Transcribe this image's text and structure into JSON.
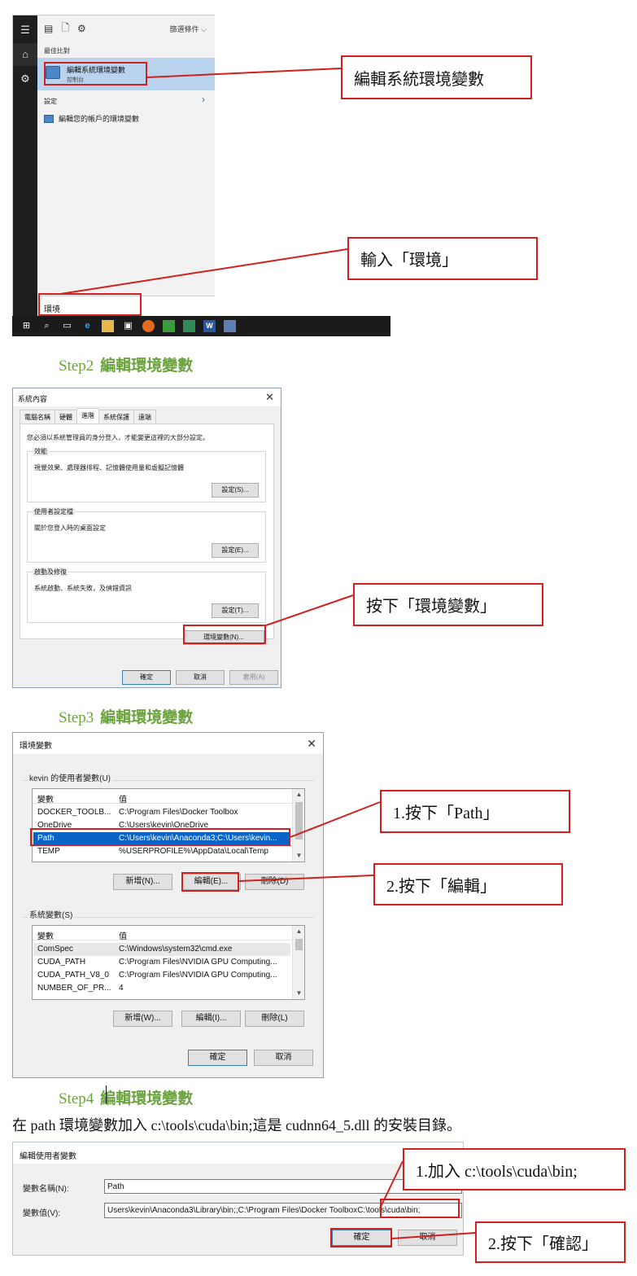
{
  "step1": {
    "start_menu": {
      "filter_label": "篩選條件",
      "best_match_label": "最佳比對",
      "best_match_title": "編輯系統環境變數",
      "best_match_subtitle": "控制台",
      "settings_label": "設定",
      "account_env_item": "編輯您的帳戶的環境變數",
      "search_text": "環境"
    },
    "callout_edit_env": "編輯系統環境變數",
    "callout_type_env": "輸入「環境」"
  },
  "step2": {
    "heading_num": "Step2",
    "heading_text": "編輯環境變數",
    "dialog": {
      "title": "系統內容",
      "tabs": [
        "電腦名稱",
        "硬體",
        "進階",
        "系統保護",
        "遠端"
      ],
      "note": "您必須以系統管理員的身分登入，才能變更這裡的大部分設定。",
      "performance": {
        "label": "效能",
        "desc": "視覺效果、處理器排程、記憶體使用量和虛擬記憶體",
        "button": "設定(S)..."
      },
      "profile": {
        "label": "使用者設定檔",
        "desc": "關於您登入時的桌面設定",
        "button": "設定(E)..."
      },
      "startup": {
        "label": "啟動及修復",
        "desc": "系統啟動、系統失敗，及偵錯資訊",
        "button": "設定(T)..."
      },
      "env_button": "環境變數(N)...",
      "ok": "確定",
      "cancel": "取消",
      "apply": "套用(A)"
    },
    "callout": "按下「環境變數」"
  },
  "step3": {
    "heading_num": "Step3",
    "heading_text": "編輯環境變數",
    "dialog": {
      "title": "環境變數",
      "user_group_label": "kevin 的使用者變數(U)",
      "col_var": "變數",
      "col_val": "值",
      "user_vars": [
        {
          "name": "DOCKER_TOOLB...",
          "value": "C:\\Program Files\\Docker Toolbox"
        },
        {
          "name": "OneDrive",
          "value": "C:\\Users\\kevin\\OneDrive"
        },
        {
          "name": "Path",
          "value": "C:\\Users\\kevin\\Anaconda3;C:\\Users\\kevin..."
        },
        {
          "name": "TEMP",
          "value": "%USERPROFILE%\\AppData\\Local\\Temp"
        }
      ],
      "user_buttons": {
        "new": "新增(N)...",
        "edit": "編輯(E)...",
        "delete": "刪除(D)"
      },
      "sys_group_label": "系統變數(S)",
      "sys_vars": [
        {
          "name": "ComSpec",
          "value": "C:\\Windows\\system32\\cmd.exe"
        },
        {
          "name": "CUDA_PATH",
          "value": "C:\\Program Files\\NVIDIA GPU Computing..."
        },
        {
          "name": "CUDA_PATH_V8_0",
          "value": "C:\\Program Files\\NVIDIA GPU Computing..."
        },
        {
          "name": "NUMBER_OF_PR...",
          "value": "4"
        }
      ],
      "sys_buttons": {
        "new": "新增(W)...",
        "edit": "編輯(I)...",
        "delete": "刪除(L)"
      },
      "ok": "確定",
      "cancel": "取消"
    },
    "callout_path": "1.按下「Path」",
    "callout_edit": "2.按下「編輯」"
  },
  "step4": {
    "heading_num": "Step4",
    "heading_text": "編輯環境變數",
    "caption": "在 path 環境變數加入 c:\\tools\\cuda\\bin;這是 cudnn64_5.dll 的安裝目錄。",
    "dialog": {
      "title": "編輯使用者變數",
      "name_label": "變數名稱(N):",
      "name_value": "Path",
      "value_label": "變數值(V):",
      "value_text": "Users\\kevin\\Anaconda3\\Library\\bin;;C:\\Program Files\\Docker Toolbox",
      "value_added": "C:\\tools\\cuda\\bin;",
      "ok": "確定",
      "cancel": "取消"
    },
    "callout_add": "1.加入 c:\\tools\\cuda\\bin;",
    "callout_confirm": "2.按下「確認」"
  },
  "colors": {
    "callout_red": "#d02020",
    "step_green": "#6aa33c",
    "selection_blue": "#0a64c8"
  }
}
